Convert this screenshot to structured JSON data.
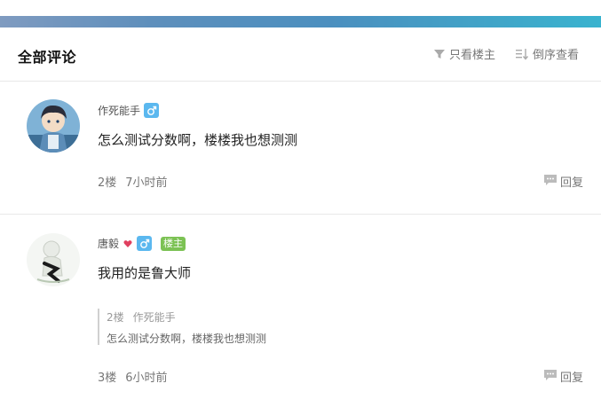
{
  "header": {
    "title": "全部评论",
    "filter_label": "只看楼主",
    "sort_label": "倒序查看"
  },
  "comments": [
    {
      "author": "作死能手",
      "gender": "male",
      "is_owner": false,
      "content": "怎么测试分数啊，楼楼我也想测测",
      "floor": "2楼",
      "time": "7小时前",
      "reply_label": "回复"
    },
    {
      "author": "唐毅",
      "gender": "male",
      "is_owner": true,
      "owner_badge": "楼主",
      "content": "我用的是鲁大师",
      "quote": {
        "floor": "2楼",
        "author": "作死能手",
        "text": "怎么测试分数啊，楼楼我也想测测"
      },
      "floor": "3楼",
      "time": "6小时前",
      "reply_label": "回复"
    }
  ],
  "colors": {
    "accent_bar": "#4b8fbf",
    "gender_badge": "#5bb8ef",
    "owner_badge": "#7cc254"
  }
}
